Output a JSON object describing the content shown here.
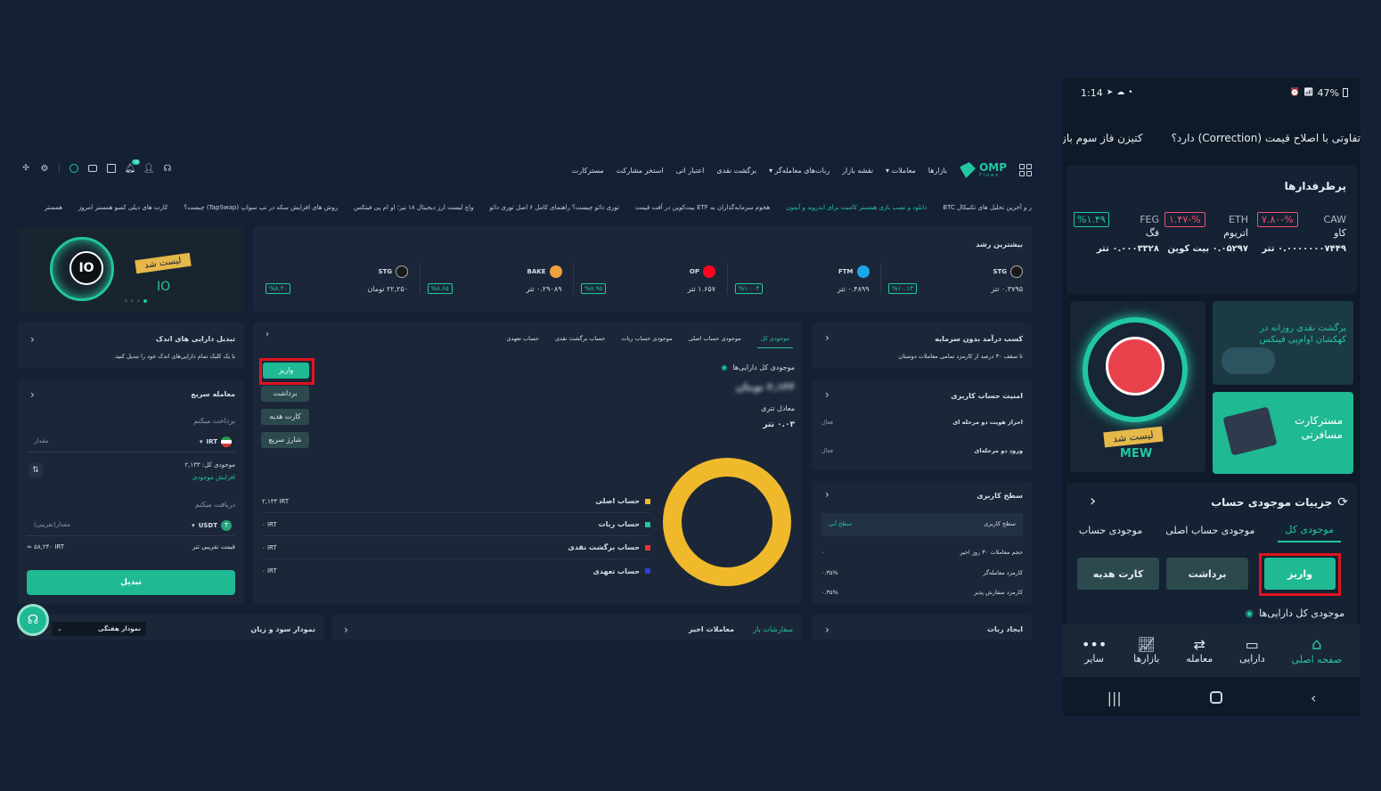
{
  "desktop": {
    "nav": {
      "logo": "OMP",
      "logo_sub": "Finex",
      "items": [
        "بازارها",
        "معاملات",
        "نقشه بازار",
        "ربات‌های معامله‌گر",
        "برگشت نقدی",
        "اعتبار اتی",
        "استخر مشارکت",
        "مسترکارت"
      ],
      "notif_count": "۱۵"
    },
    "ticker": [
      "ر و آخرین تحلیل های تکنیکال BTC",
      "دانلود و نصب بازی همستر کامبت برای اندروید و آیفون",
      "هجوم سرمایه‌گذاران به ETF بیت‌کوین در اَفت قیمت",
      "توری دائو چیست؟ راهنمای کامل ۶ اصل توری دائو",
      "واچ لیست ارز دیجیتال ۱۸ تیر؛ او ام پی فینکس",
      "روش های افزایش سکه در تپ سواپ (TapSwap) چیست؟",
      "کارت های دیلی کمبو همستر امروز",
      "همستر"
    ],
    "banner_left": {
      "title": "لیست شد",
      "coin": "IO"
    },
    "growth": {
      "title": "بیشترین رشد",
      "items": [
        {
          "symbol": "STG",
          "price": "۰.۳۷۹۵ تتر",
          "change": "%۱۰.۱۳"
        },
        {
          "symbol": "FTM",
          "price": "۰.۴۸۹۹ تتر",
          "change": "%۱۰.۰۴"
        },
        {
          "symbol": "OP",
          "price": "۱.۶۵۷ تتر",
          "change": "%۸.۹۵"
        },
        {
          "symbol": "BAKE",
          "price": "۰.۲۹۰۸۹ تتر",
          "change": "%۸.۶۵"
        },
        {
          "symbol": "STG",
          "price": "۲۲,۲۵۰ تومان",
          "change": "%۸.۲۰"
        }
      ]
    },
    "convert_small": {
      "title": "تبدیل دارایی های اندک",
      "desc": "با یک کلیک تمام دارایی‌های اندک خود را تبدیل کنید."
    },
    "quick_trade": {
      "title": "معامله سریع",
      "pay_label": "پرداخت میکنم",
      "pay_currency": "IRT",
      "pay_placeholder": "مقدار",
      "balance": "موجودی کل: ۲,۱۳۳",
      "increase": "افزایش موجودی",
      "receive_label": "دریافت میکنم",
      "receive_currency": "USDT",
      "receive_placeholder": "مقدار(تقریبی)",
      "approx_label": "قیمت تقریبی تتر",
      "approx_value": "≈ ۵۸,۲۴۰ IRT",
      "convert_btn": "تبدیل"
    },
    "wallet": {
      "tabs": [
        "موجودی کل",
        "موجودی حساب اصلی",
        "موجودی حساب ربات",
        "حساب برگشت نقدی",
        "حساب تعهدی"
      ],
      "buttons": [
        "واریز",
        "برداشت",
        "کارت هدیه",
        "شارژ سریع"
      ],
      "total_label": "موجودی کل دارایی‌ها",
      "total_value": "۲,۱۳۳ تومان",
      "tether_label": "معادل تتری",
      "tether_value": "۰.۰۳ تتر",
      "accounts": [
        {
          "name": "حساب اصلی",
          "value": "۲,۱۳۳ IRT",
          "color": "#f0b92c"
        },
        {
          "name": "حساب ربات",
          "value": "۰ IRT",
          "color": "#22c7a0"
        },
        {
          "name": "حساب برگشت نقدی",
          "value": "۰ IRT",
          "color": "#e83535"
        },
        {
          "name": "حساب تعهدی",
          "value": "۰ IRT",
          "color": "#2f3fd8"
        }
      ]
    },
    "income": {
      "title": "کسب درآمد بدون سرمایه",
      "desc": "تا سقف ۳۰ درصد از کارمزد تمامی معاملات دوستان"
    },
    "security": {
      "title": "امنیت حساب کاربری",
      "items": [
        {
          "label": "احراز هویت دو مرحله ای",
          "state": "فعال"
        },
        {
          "label": "ورود دو مرحله‌ای",
          "state": "فعال"
        }
      ]
    },
    "level": {
      "title": "سطح کاربری",
      "level_label": "سطح کاربری",
      "level_value": "سطح آبی",
      "rows": [
        {
          "label": "حجم معاملات ۳۰ روز اخیر",
          "value": "۰"
        },
        {
          "label": "کارمزد معامله‌گر",
          "value": "۰.۳۵%"
        },
        {
          "label": "کارمزد سفارش پذیر",
          "value": "۰.۳۵%"
        }
      ]
    },
    "bottom": {
      "pnl_title": "نمودار سود و زیان",
      "pnl_select": "نمودار هفتگی",
      "trades_tab": "معاملات اخیر",
      "orders_tab": "سفارشات باز",
      "robot_title": "ایجاد ربات"
    }
  },
  "mobile": {
    "status": {
      "time": "1:14",
      "battery": "47%"
    },
    "news": [
      "تفاوتی با اصلاح قیمت (Correction) دارد؟",
      "کتیزن فاز سوم بازی را اس"
    ],
    "popular": {
      "title": "پرطرفدارها",
      "items": [
        {
          "symbol": "CAW",
          "name": "کاو",
          "change": "%-۷.۸۰",
          "price": "۰.۰۰۰۰۰۰۰۷۴۴۹ تتر"
        },
        {
          "symbol": "ETH",
          "name": "اتریوم",
          "change": "%-۱.۴۷",
          "price": "۰.۰۵۲۹۷ بیت کوین"
        },
        {
          "symbol": "FEG",
          "name": "فگ",
          "change": "%۱.۴۹",
          "price": "۰.۰۰۰۳۳۲۸ تتر"
        }
      ]
    },
    "banner_left": {
      "title": "لیست شد",
      "coin": "MEW"
    },
    "banner_cashback": "برگشت نقدی روزانه در کهکشان اوام‌پی فینکس",
    "banner_master": "مسترکارت مسافرتی",
    "balance": {
      "title": "جزییات موجودی حساب",
      "tabs": [
        "موجودی کل",
        "موجودی حساب اصلی",
        "موجودی حساب"
      ],
      "buttons": [
        "واریز",
        "برداشت",
        "کارت هدیه"
      ],
      "total_label": "موجودی کل دارایی‌ها"
    },
    "bottom_nav": [
      "صفحه اصلی",
      "دارایی",
      "معامله",
      "بازارها",
      "سایر"
    ]
  },
  "colors": {
    "accent": "#22c7a0",
    "highlight": "#e0141e",
    "donut": "#f0b92c"
  }
}
